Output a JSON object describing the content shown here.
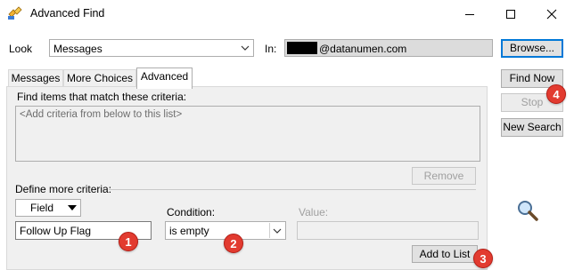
{
  "window": {
    "title": "Advanced Find",
    "controls": {
      "minimize": "minimize-icon",
      "maximize": "maximize-icon",
      "close": "close-icon"
    }
  },
  "look": {
    "label": "Look",
    "value": "Messages",
    "in_label": "In:",
    "in_value": "@datanumen.com",
    "browse_button": "Browse..."
  },
  "tabs": [
    {
      "label": "Messages"
    },
    {
      "label": "More Choices"
    },
    {
      "label": "Advanced",
      "active": true
    }
  ],
  "criteria": {
    "heading": "Find items that match these criteria:",
    "placeholder": "<Add criteria from below to this list>",
    "remove_button": "Remove"
  },
  "define": {
    "heading": "Define more criteria:",
    "field_button": "Field",
    "field_value": "Follow Up Flag",
    "condition_label": "Condition:",
    "condition_value": "is empty",
    "value_label": "Value:",
    "value_value": "",
    "add_button": "Add to List"
  },
  "actions": {
    "find_now": "Find Now",
    "stop": "Stop",
    "new_search": "New Search"
  },
  "annotations": [
    "1",
    "2",
    "3",
    "4"
  ],
  "colors": {
    "marker": "#e23b30",
    "focus": "#0078d7"
  }
}
